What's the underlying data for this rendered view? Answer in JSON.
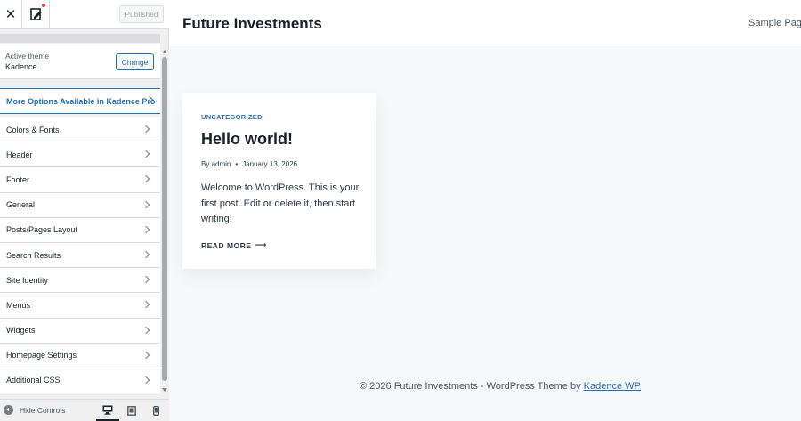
{
  "topbar": {
    "published_label": "Published"
  },
  "theme": {
    "label": "Active theme",
    "name": "Kadence",
    "change_label": "Change"
  },
  "pro_link": {
    "label": "More Options Available in Kadence Pro"
  },
  "panels": [
    {
      "label": "Colors & Fonts"
    },
    {
      "label": "Header"
    },
    {
      "label": "Footer"
    },
    {
      "label": "General"
    },
    {
      "label": "Posts/Pages Layout"
    },
    {
      "label": "Search Results"
    },
    {
      "label": "Site Identity"
    },
    {
      "label": "Menus"
    },
    {
      "label": "Widgets"
    },
    {
      "label": "Homepage Settings"
    },
    {
      "label": "Additional CSS"
    }
  ],
  "footer_bar": {
    "hide_label": "Hide Controls"
  },
  "preview": {
    "site_title": "Future Investments",
    "nav_item": "Sample Page",
    "post": {
      "category": "UNCATEGORIZED",
      "title": "Hello world!",
      "by": "By",
      "author": "admin",
      "separator": "•",
      "date": "January 13, 2026",
      "excerpt": "Welcome to WordPress. This is your first post. Edit or delete it, then start writing!",
      "read_more": "READ MORE",
      "arrow": "⟶"
    },
    "footer": {
      "text": "© 2026 Future Investments - WordPress Theme by ",
      "link": "Kadence WP"
    }
  }
}
